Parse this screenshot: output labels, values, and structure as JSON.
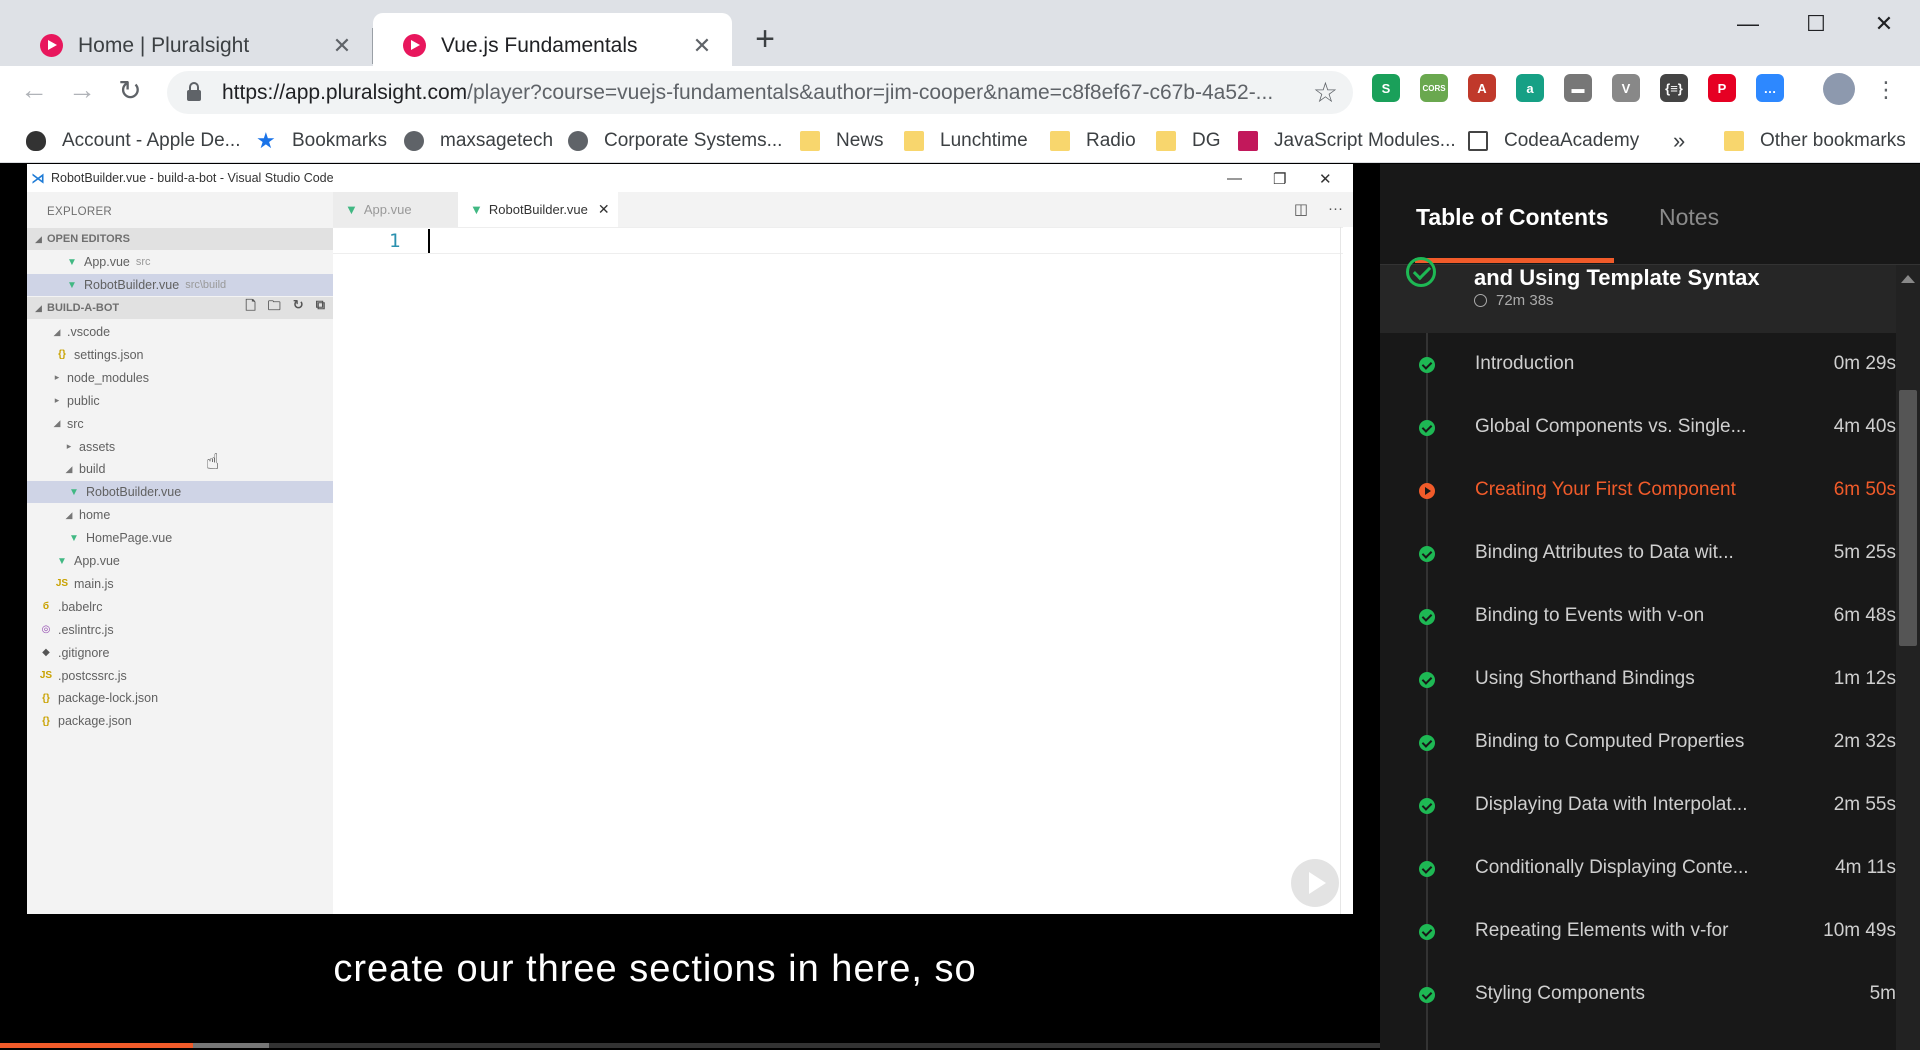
{
  "browser": {
    "tabs": [
      {
        "label": "Home | Pluralsight",
        "close": "✕"
      },
      {
        "label": "Vue.js Fundamentals",
        "close": "✕"
      }
    ],
    "new_tab": "+",
    "window_controls": {
      "minimize": "—",
      "maximize": "☐",
      "close": "✕"
    },
    "url_host": "https://app.pluralsight.com",
    "url_path": "/player?course=vuejs-fundamentals&author=jim-cooper&name=c8f8ef67-c67b-4a52-...",
    "extensions": [
      {
        "icon": "scrivener-icon",
        "glyph": "S",
        "color": "#1aa05a"
      },
      {
        "icon": "cors-icon",
        "glyph": "CORS",
        "color": "#6aa84f"
      },
      {
        "icon": "pdf-icon",
        "glyph": "A",
        "color": "#c0392b"
      },
      {
        "icon": "a-icon",
        "glyph": "a",
        "color": "#16a085"
      },
      {
        "icon": "comment-icon",
        "glyph": "▬",
        "color": "#777777"
      },
      {
        "icon": "vue-devtools-icon",
        "glyph": "V",
        "color": "#888888"
      },
      {
        "icon": "json-icon",
        "glyph": "{≡}",
        "color": "#444444"
      },
      {
        "icon": "pinterest-icon",
        "glyph": "P",
        "color": "#e60023"
      },
      {
        "icon": "messenger-icon",
        "glyph": "…",
        "color": "#2d88ff"
      }
    ],
    "bookmarks": [
      {
        "label": "Account - Apple De...",
        "icon": "apple-icon"
      },
      {
        "label": "Bookmarks",
        "icon": "star-icon"
      },
      {
        "label": "maxsagetech",
        "icon": "globe-icon"
      },
      {
        "label": "Corporate Systems...",
        "icon": "globe-icon"
      },
      {
        "label": "News",
        "icon": "folder-icon"
      },
      {
        "label": "Lunchtime",
        "icon": "folder-icon"
      },
      {
        "label": "Radio",
        "icon": "folder-icon"
      },
      {
        "label": "DG",
        "icon": "folder-icon"
      },
      {
        "label": "JavaScript Modules...",
        "icon": "js-modules-icon"
      },
      {
        "label": "CodeaAcademy",
        "icon": "codeacademy-icon"
      }
    ],
    "bookmarks_overflow": "»",
    "other_bookmarks": "Other bookmarks"
  },
  "vscode": {
    "title": "RobotBuilder.vue - build-a-bot - Visual Studio Code",
    "explorer_label": "EXPLORER",
    "open_editors_label": "OPEN EDITORS",
    "open_editors": [
      {
        "name": "App.vue",
        "path": "src"
      },
      {
        "name": "RobotBuilder.vue",
        "path": "src\\build"
      }
    ],
    "project_label": "BUILD-A-BOT",
    "tree": [
      {
        "name": ".vscode"
      },
      {
        "name": "settings.json"
      },
      {
        "name": "node_modules"
      },
      {
        "name": "public"
      },
      {
        "name": "src"
      },
      {
        "name": "assets"
      },
      {
        "name": "build"
      },
      {
        "name": "RobotBuilder.vue"
      },
      {
        "name": "home"
      },
      {
        "name": "HomePage.vue"
      },
      {
        "name": "App.vue"
      },
      {
        "name": "main.js"
      },
      {
        "name": ".babelrc"
      },
      {
        "name": ".eslintrc.js"
      },
      {
        "name": ".gitignore"
      },
      {
        "name": ".postcssrc.js"
      },
      {
        "name": "package-lock.json"
      },
      {
        "name": "package.json"
      }
    ],
    "editor_tabs": [
      {
        "label": "App.vue"
      },
      {
        "label": "RobotBuilder.vue"
      }
    ],
    "line_number": "1"
  },
  "caption": "create our three sections in here, so",
  "progress": {
    "played_fraction": 0.14,
    "buffered_fraction": 0.195
  },
  "panel": {
    "tab_contents": "Table of Contents",
    "tab_notes": "Notes",
    "module_title": "and Using Template Syntax",
    "module_duration": "72m 38s",
    "clips": [
      {
        "title": "Introduction",
        "duration": "0m 29s",
        "state": "done"
      },
      {
        "title": "Global Components vs. Single...",
        "duration": "4m 40s",
        "state": "done"
      },
      {
        "title": "Creating Your First Component",
        "duration": "6m 50s",
        "state": "current"
      },
      {
        "title": "Binding Attributes to Data wit...",
        "duration": "5m 25s",
        "state": "done"
      },
      {
        "title": "Binding to Events with v-on",
        "duration": "6m 48s",
        "state": "done"
      },
      {
        "title": "Using Shorthand Bindings",
        "duration": "1m 12s",
        "state": "done"
      },
      {
        "title": "Binding to Computed Properties",
        "duration": "2m 32s",
        "state": "done"
      },
      {
        "title": "Displaying Data with Interpolat...",
        "duration": "2m 55s",
        "state": "done"
      },
      {
        "title": "Conditionally Displaying Conte...",
        "duration": "4m 11s",
        "state": "done"
      },
      {
        "title": "Repeating Elements with v-for",
        "duration": "10m 49s",
        "state": "done"
      },
      {
        "title": "Styling Components",
        "duration": "5m",
        "state": "done"
      }
    ]
  },
  "colors": {
    "accent": "#f15b2a",
    "complete": "#1eb854",
    "vue": "#41b883"
  }
}
